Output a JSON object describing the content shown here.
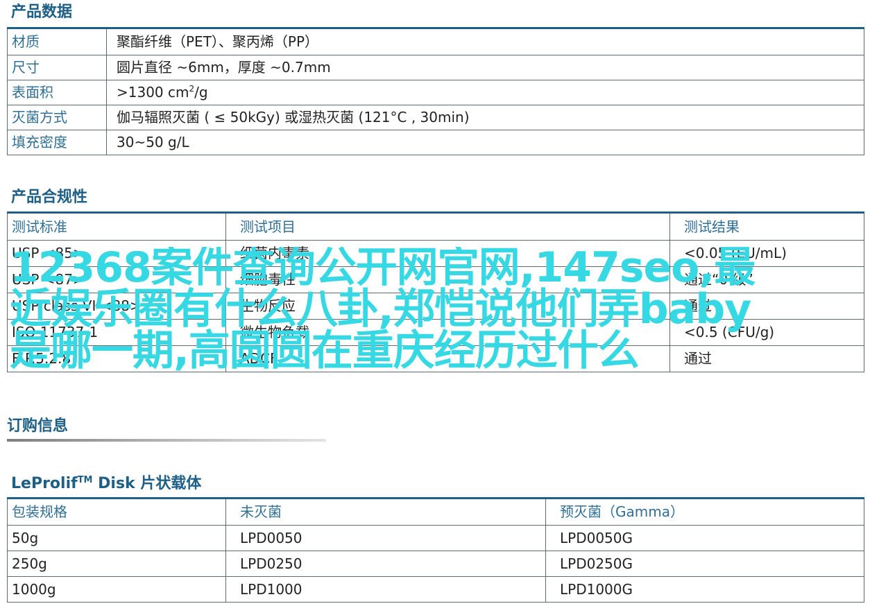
{
  "product_data": {
    "title": "产品数据",
    "rows": [
      {
        "key": "材质",
        "value": "聚酯纤维（PET）、聚丙烯（PP）"
      },
      {
        "key": "尺寸",
        "value": "圆片直径 ~6mm，厚度 ~0.7mm"
      },
      {
        "key": "表面积",
        "value_prefix": ">1300 cm",
        "value_sup": "2",
        "value_suffix": "/g"
      },
      {
        "key": "灭菌方式",
        "value": "伽马辐照灭菌 ( ≤ 50kGy) 或湿热灭菌 (121°C , 30min)"
      },
      {
        "key": "填充密度",
        "value": "30~50 g/L"
      }
    ]
  },
  "compliance": {
    "title": "产品合规性",
    "headers": [
      "测试标准",
      "测试项目",
      "测试结果"
    ],
    "rows": [
      [
        "USP <85>",
        "细菌内毒素",
        "<0.05 (EU/mL)"
      ],
      [
        "USP <87>",
        "细胞毒性",
        "通过“0 级”"
      ],
      [
        "USP class VI <88>",
        "生物反应",
        "通过"
      ],
      [
        "ISO 11737-1",
        "微生物负载",
        "<0.5 (CFU/g)"
      ],
      [
        "E.P.5.2.8",
        "ADCF",
        "通过"
      ]
    ]
  },
  "ordering": {
    "title": "订购信息",
    "product_title_prefix": "LeProlif",
    "product_title_sup": "TM",
    "product_title_suffix": " Disk 片状载体",
    "headers": [
      "包装规格",
      "未灭菌",
      "预灭菌（Gamma）"
    ],
    "rows": [
      [
        "50g",
        "LPD0050",
        "LPD0050G"
      ],
      [
        "250g",
        "LPD0250",
        "LPD0250G"
      ],
      [
        "1000g",
        "LPD1000",
        "LPD1000G"
      ]
    ]
  },
  "overlay_text": "12368案件查询公开网官网,147seo,最近娱乐圈有什么八卦,郑恺说他们弄baby是哪一期,高圆圆在重庆经历过什么",
  "colors": {
    "accent": "#1d5f86",
    "key_text": "#2f6f96",
    "border": "#5e6a73",
    "overlay": "#35d8e3"
  }
}
